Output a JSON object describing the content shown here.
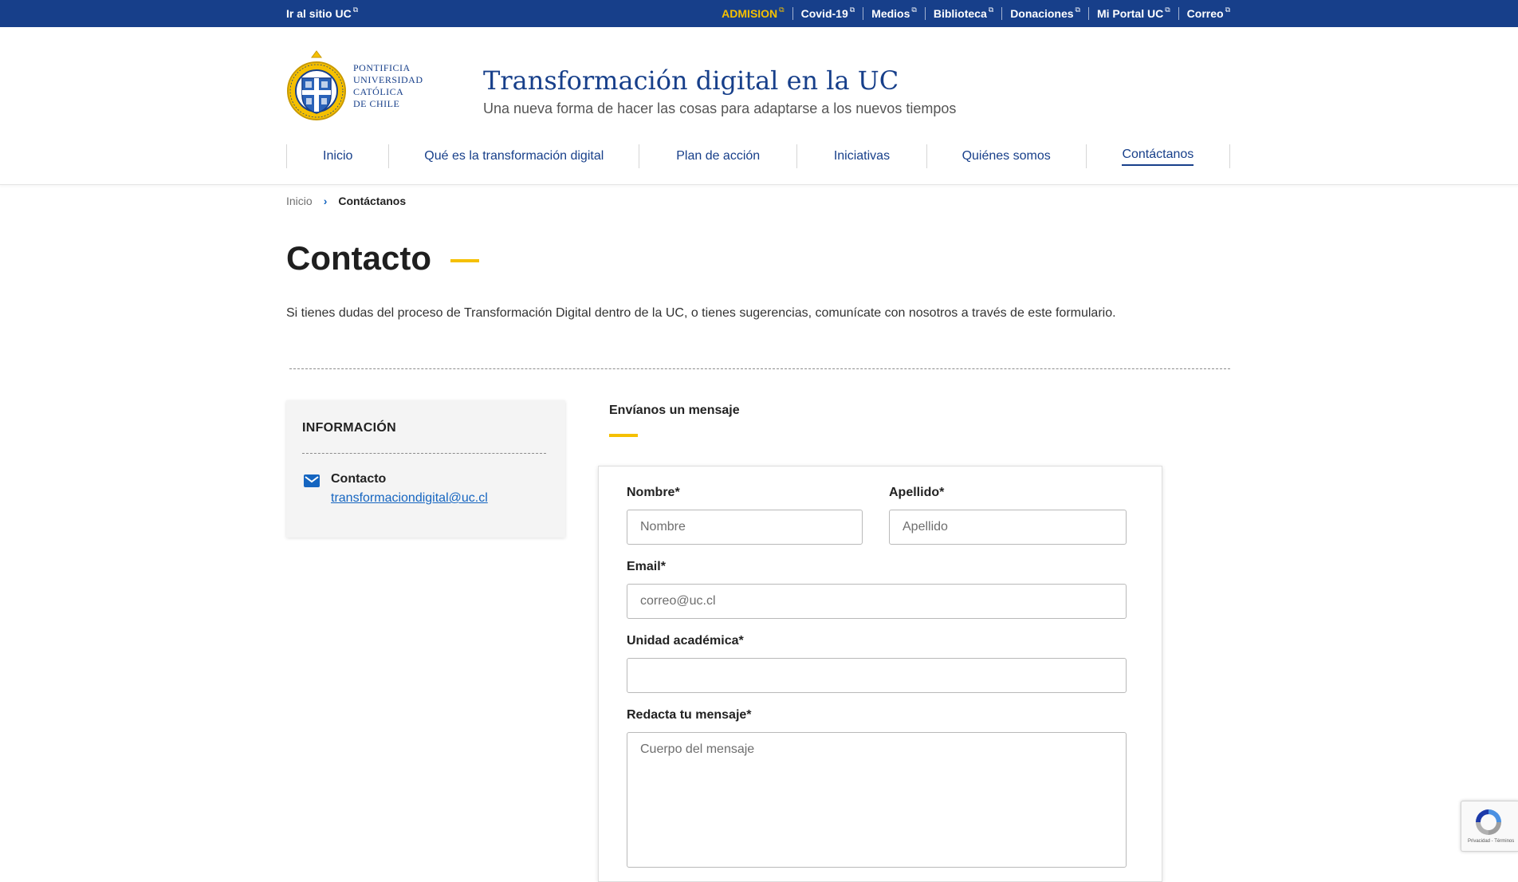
{
  "topbar": {
    "left_link": "Ir al sitio UC",
    "links": [
      {
        "label": "ADMISION",
        "highlight": true
      },
      {
        "label": "Covid-19"
      },
      {
        "label": "Medios"
      },
      {
        "label": "Biblioteca"
      },
      {
        "label": "Donaciones"
      },
      {
        "label": "Mi Portal UC"
      },
      {
        "label": "Correo"
      }
    ],
    "external_icon": "external-link-icon",
    "bg_color": "#173f8a",
    "highlight_color": "#f5c000"
  },
  "header": {
    "logo_lines": [
      "PONTIFICIA",
      "UNIVERSIDAD",
      "CATÓLICA",
      "DE CHILE"
    ],
    "title": "Transformación digital en la UC",
    "subtitle": "Una nueva forma de hacer las cosas para adaptarse a los nuevos tiempos"
  },
  "nav": {
    "items": [
      {
        "label": "Inicio"
      },
      {
        "label": "Qué es la transformación digital"
      },
      {
        "label": "Plan de acción"
      },
      {
        "label": "Iniciativas"
      },
      {
        "label": "Quiénes somos"
      },
      {
        "label": "Contáctanos",
        "active": true
      }
    ]
  },
  "breadcrumb": {
    "home": "Inicio",
    "separator_icon": "chevron-right-icon",
    "current": "Contáctanos"
  },
  "page": {
    "title": "Contacto",
    "intro": "Si tienes dudas del proceso de Transformación Digital dentro de la UC, o tienes sugerencias, comunícate con nosotros a través de este formulario."
  },
  "info": {
    "title": "INFORMACIÓN",
    "icon": "mail-icon",
    "contact_label": "Contacto",
    "email": "transformaciondigital@uc.cl"
  },
  "form": {
    "heading": "Envíanos un mensaje",
    "nombre_label": "Nombre*",
    "nombre_placeholder": "Nombre",
    "apellido_label": "Apellido*",
    "apellido_placeholder": "Apellido",
    "email_label": "Email*",
    "email_placeholder": "correo@uc.cl",
    "unidad_label": "Unidad académica*",
    "unidad_placeholder": "",
    "mensaje_label": "Redacta tu mensaje*",
    "mensaje_placeholder": "Cuerpo del mensaje"
  },
  "recaptcha": {
    "terms": "Privacidad - Términos",
    "icon": "recaptcha-icon"
  },
  "colors": {
    "primary": "#173f8a",
    "accent": "#f5c000",
    "link": "#1565c0"
  }
}
